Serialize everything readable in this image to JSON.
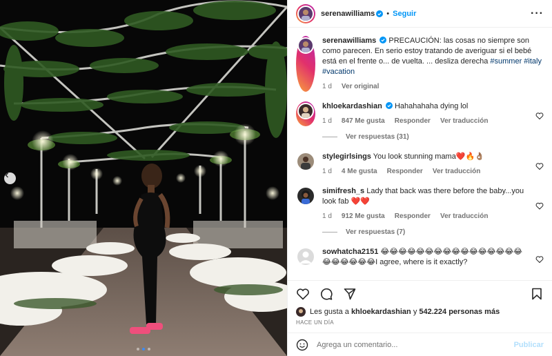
{
  "post": {
    "author": "serenawilliams",
    "follow_label": "Seguir",
    "separator": "•",
    "more_label": "···",
    "caption": {
      "text": "PRECAUCIÓN: las cosas no siempre son como parecen. En serio estoy tratando de averiguar si el bebé está en el frente o... de vuelta. ... desliza derecha",
      "hashtags": [
        "#summer",
        "#italy",
        "#vacation"
      ],
      "time": "1 d",
      "translate_label": "Ver original"
    },
    "comments": [
      {
        "user": "khloekardashian",
        "verified": true,
        "text": "Hahahahaha dying lol",
        "time": "1 d",
        "likes": "847 Me gusta",
        "reply": "Responder",
        "translate": "Ver traducción",
        "replies": "Ver respuestas (31)"
      },
      {
        "user": "stylegirlsings",
        "verified": false,
        "text": "You look stunning mama❤️🔥👌🏽",
        "time": "1 d",
        "likes": "4 Me gusta",
        "reply": "Responder",
        "translate": "Ver traducción",
        "replies": ""
      },
      {
        "user": "simifresh_s",
        "verified": false,
        "text": "Lady that back was there before the baby...you look fab ❤️❤️",
        "time": "1 d",
        "likes": "912 Me gusta",
        "reply": "Responder",
        "translate": "Ver traducción",
        "replies": "Ver respuestas (7)"
      },
      {
        "user": "sowhatcha2151",
        "verified": false,
        "text": "😂😂😂😂😂😂😂😂😂😂😂😂😂😂😂😂😂😂😂😂😂😂I agree, where is it exactly?",
        "time": "",
        "likes": "",
        "reply": "",
        "translate": "",
        "replies": ""
      }
    ],
    "likes_prefix": "Les gusta a",
    "likes_user": "khloekardashian",
    "likes_and": "y",
    "likes_count": "542.224 personas más",
    "timestamp": "HACE UN DÍA",
    "composer_placeholder": "Agrega un comentario...",
    "post_label": "Publicar",
    "carousel": {
      "slides": 3,
      "active": 1
    }
  },
  "icons": {
    "prev": "chevron-left-icon",
    "heart": "heart-icon",
    "comment": "comment-icon",
    "share": "send-icon",
    "save": "bookmark-icon",
    "emoji": "emoji-icon",
    "more": "more-icon"
  },
  "colors": {
    "accent": "#0095f6",
    "hashtag": "#00376b",
    "muted": "#737373",
    "post_disabled": "#b2dffc"
  }
}
